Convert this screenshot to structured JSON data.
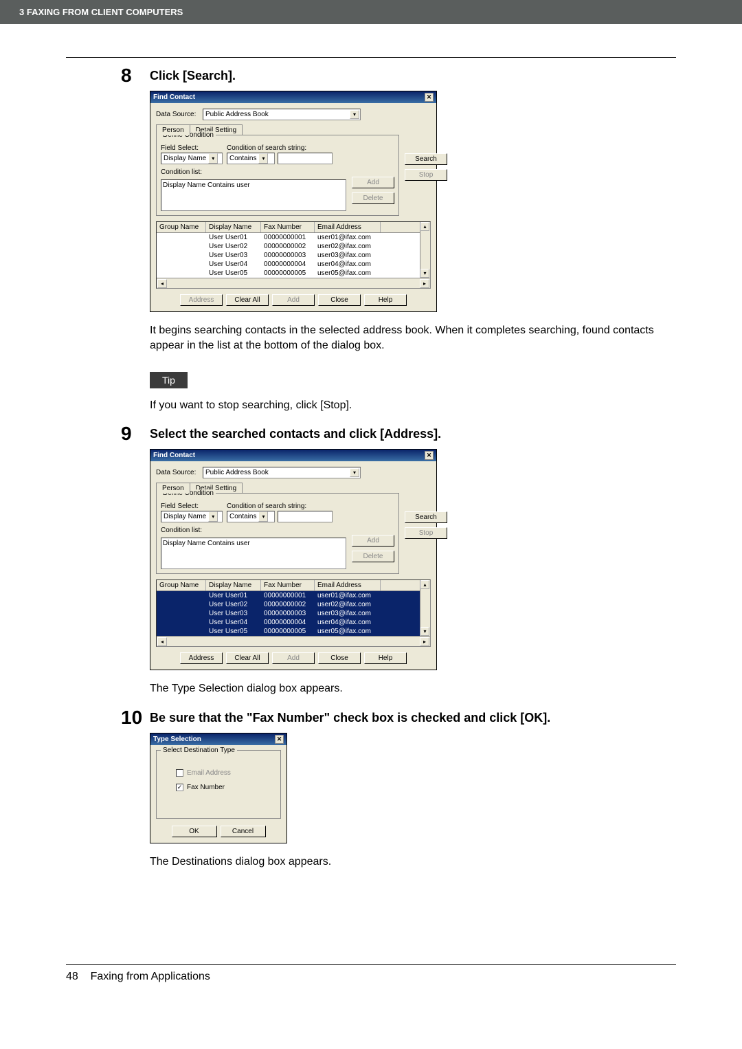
{
  "header": {
    "chapter": "3    FAXING FROM CLIENT COMPUTERS"
  },
  "step8": {
    "num": "8",
    "title": "Click [Search].",
    "para": "It begins searching contacts in the selected address book. When it completes searching, found contacts appear in the list at the bottom of the dialog box.",
    "tip_label": "Tip",
    "tip_text": "If you want to stop searching, click [Stop]."
  },
  "step9": {
    "num": "9",
    "title": "Select the searched contacts and click [Address].",
    "para": "The Type Selection dialog box appears."
  },
  "step10": {
    "num": "10",
    "title": "Be sure that the \"Fax Number\" check box is checked and click [OK].",
    "para": "The Destinations dialog box appears."
  },
  "find_dialog": {
    "title": "Find Contact",
    "data_source_label": "Data Source:",
    "data_source_value": "Public Address Book",
    "tab_person": "Person",
    "tab_detail": "Detail Setting",
    "fs_legend": "Define Condition",
    "field_select_label": "Field Select:",
    "field_select_value": "Display Name",
    "cond_string_label": "Condition of search string:",
    "cond_string_value": "Contains",
    "search_value": "",
    "cond_list_label": "Condition list:",
    "cond_list_item": "Display Name Contains user",
    "btn_add": "Add",
    "btn_delete": "Delete",
    "btn_search": "Search",
    "btn_stop": "Stop",
    "btn_address": "Address",
    "btn_clearall": "Clear All",
    "btn_add2": "Add",
    "btn_close": "Close",
    "btn_help": "Help",
    "col_group": "Group Name",
    "col_display": "Display Name",
    "col_fax": "Fax Number",
    "col_email": "Email Address",
    "rows": [
      {
        "disp": "User User01",
        "fax": "00000000001",
        "em": "user01@ifax.com"
      },
      {
        "disp": "User User02",
        "fax": "00000000002",
        "em": "user02@ifax.com"
      },
      {
        "disp": "User User03",
        "fax": "00000000003",
        "em": "user03@ifax.com"
      },
      {
        "disp": "User User04",
        "fax": "00000000004",
        "em": "user04@ifax.com"
      },
      {
        "disp": "User User05",
        "fax": "00000000005",
        "em": "user05@ifax.com"
      }
    ]
  },
  "type_dialog": {
    "title": "Type Selection",
    "fs_legend": "Select Destination Type",
    "email_label": "Email Address",
    "fax_label": "Fax Number",
    "btn_ok": "OK",
    "btn_cancel": "Cancel"
  },
  "footer": {
    "page": "48",
    "section": "Faxing from Applications"
  }
}
